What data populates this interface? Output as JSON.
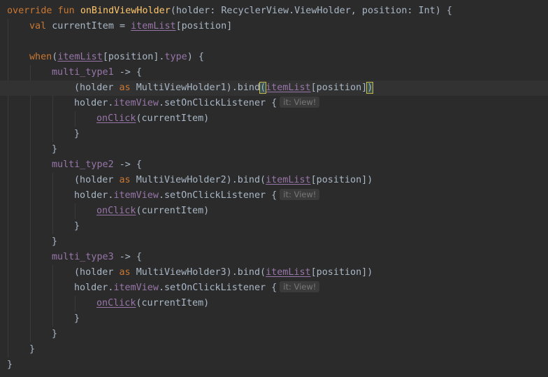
{
  "editor": {
    "lines": [
      {
        "indent": 0,
        "tokens": [
          {
            "t": "override fun ",
            "c": "keyword"
          },
          {
            "t": "onBindViewHolder",
            "c": "fn"
          },
          {
            "t": "(holder: RecyclerView.ViewHolder, position: Int) {",
            "c": "plain"
          }
        ]
      },
      {
        "indent": 1,
        "tokens": [
          {
            "t": "val ",
            "c": "keyword"
          },
          {
            "t": "currentItem = ",
            "c": "plain"
          },
          {
            "t": "itemList",
            "c": "prop-u"
          },
          {
            "t": "[position]",
            "c": "plain"
          }
        ]
      },
      {
        "indent": 0,
        "tokens": []
      },
      {
        "indent": 1,
        "tokens": [
          {
            "t": "when",
            "c": "keyword"
          },
          {
            "t": "(",
            "c": "plain"
          },
          {
            "t": "itemList",
            "c": "prop-u"
          },
          {
            "t": "[position].",
            "c": "plain"
          },
          {
            "t": "type",
            "c": "prop"
          },
          {
            "t": ") {",
            "c": "plain"
          }
        ]
      },
      {
        "indent": 2,
        "tokens": [
          {
            "t": "multi_type1",
            "c": "prop"
          },
          {
            "t": " -> {",
            "c": "plain"
          }
        ]
      },
      {
        "indent": 3,
        "current": true,
        "tokens": [
          {
            "t": "(holder ",
            "c": "plain"
          },
          {
            "t": "as ",
            "c": "keyword"
          },
          {
            "t": "MultiViewHolder1).bind",
            "c": "plain"
          },
          {
            "t": "(",
            "c": "brace-hl"
          },
          {
            "t": "itemList",
            "c": "prop-u"
          },
          {
            "t": "[position]",
            "c": "plain"
          },
          {
            "t": ")",
            "c": "brace-hl"
          }
        ]
      },
      {
        "indent": 3,
        "tokens": [
          {
            "t": "holder.",
            "c": "plain"
          },
          {
            "t": "itemView",
            "c": "prop"
          },
          {
            "t": ".setOnClickListener {",
            "c": "plain"
          },
          {
            "t": "it: View!",
            "c": "hint"
          }
        ]
      },
      {
        "indent": 4,
        "tokens": [
          {
            "t": "onClick",
            "c": "prop-call-u"
          },
          {
            "t": "(currentItem)",
            "c": "plain"
          }
        ]
      },
      {
        "indent": 3,
        "tokens": [
          {
            "t": "}",
            "c": "plain"
          }
        ]
      },
      {
        "indent": 2,
        "tokens": [
          {
            "t": "}",
            "c": "plain"
          }
        ]
      },
      {
        "indent": 2,
        "tokens": [
          {
            "t": "multi_type2",
            "c": "prop"
          },
          {
            "t": " -> {",
            "c": "plain"
          }
        ]
      },
      {
        "indent": 3,
        "tokens": [
          {
            "t": "(holder ",
            "c": "plain"
          },
          {
            "t": "as ",
            "c": "keyword"
          },
          {
            "t": "MultiViewHolder2).bind(",
            "c": "plain"
          },
          {
            "t": "itemList",
            "c": "prop-u"
          },
          {
            "t": "[position])",
            "c": "plain"
          }
        ]
      },
      {
        "indent": 3,
        "tokens": [
          {
            "t": "holder.",
            "c": "plain"
          },
          {
            "t": "itemView",
            "c": "prop"
          },
          {
            "t": ".setOnClickListener {",
            "c": "plain"
          },
          {
            "t": "it: View!",
            "c": "hint"
          }
        ]
      },
      {
        "indent": 4,
        "tokens": [
          {
            "t": "onClick",
            "c": "prop-call-u"
          },
          {
            "t": "(currentItem)",
            "c": "plain"
          }
        ]
      },
      {
        "indent": 3,
        "tokens": [
          {
            "t": "}",
            "c": "plain"
          }
        ]
      },
      {
        "indent": 2,
        "tokens": [
          {
            "t": "}",
            "c": "plain"
          }
        ]
      },
      {
        "indent": 2,
        "tokens": [
          {
            "t": "multi_type3",
            "c": "prop"
          },
          {
            "t": " -> {",
            "c": "plain"
          }
        ]
      },
      {
        "indent": 3,
        "tokens": [
          {
            "t": "(holder ",
            "c": "plain"
          },
          {
            "t": "as ",
            "c": "keyword"
          },
          {
            "t": "MultiViewHolder3).bind(",
            "c": "plain"
          },
          {
            "t": "itemList",
            "c": "prop-u"
          },
          {
            "t": "[position])",
            "c": "plain"
          }
        ]
      },
      {
        "indent": 3,
        "tokens": [
          {
            "t": "holder.",
            "c": "plain"
          },
          {
            "t": "itemView",
            "c": "prop"
          },
          {
            "t": ".setOnClickListener {",
            "c": "plain"
          },
          {
            "t": "it: View!",
            "c": "hint"
          }
        ]
      },
      {
        "indent": 4,
        "tokens": [
          {
            "t": "onClick",
            "c": "prop-call-u"
          },
          {
            "t": "(currentItem)",
            "c": "plain"
          }
        ]
      },
      {
        "indent": 3,
        "tokens": [
          {
            "t": "}",
            "c": "plain"
          }
        ]
      },
      {
        "indent": 2,
        "tokens": [
          {
            "t": "}",
            "c": "plain"
          }
        ]
      },
      {
        "indent": 1,
        "tokens": [
          {
            "t": "}",
            "c": "plain"
          }
        ]
      },
      {
        "indent": 0,
        "tokens": [
          {
            "t": "}",
            "c": "plain"
          }
        ]
      }
    ]
  },
  "theme": {
    "background": "#2b2b2b",
    "current_line": "#323232",
    "keyword": "#cc7832",
    "function": "#ffc66d",
    "property": "#9876aa",
    "text": "#a9b7c6",
    "hint_bg": "#3b3b3b",
    "hint_fg": "#787878"
  }
}
